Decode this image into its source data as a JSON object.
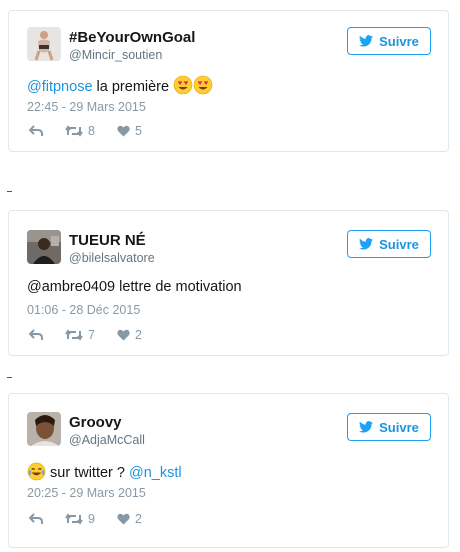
{
  "tweets": [
    {
      "display_name": "#BeYourOwnGoal",
      "handle": "@Mincir_soutien",
      "follow_label": "Suivre",
      "text_mention": "@fitpnose",
      "text_body": " la première ",
      "timestamp": "22:45 - 29 Mars 2015",
      "retweets": "8",
      "likes": "5"
    },
    {
      "display_name": "TUEUR NÉ",
      "handle": "@bilelsalvatore",
      "follow_label": "Suivre",
      "text_body": "@ambre0409 lettre de motivation",
      "timestamp": "01:06 - 28 Déc 2015",
      "retweets": "7",
      "likes": "2"
    },
    {
      "display_name": "Groovy",
      "handle": "@AdjaMcCall",
      "follow_label": "Suivre",
      "text_body": " sur twitter ? ",
      "text_mention": "@n_kstl",
      "timestamp": "20:25 - 29 Mars 2015",
      "retweets": "9",
      "likes": "2"
    }
  ],
  "separators": [
    "-",
    "-"
  ],
  "colors": {
    "accent": "#1b95e0",
    "muted": "#8899a6",
    "border": "#e1e8ed"
  },
  "icons": [
    "twitter-bird-icon",
    "reply-icon",
    "retweet-icon",
    "heart-icon",
    "heart-eyes-emoji",
    "tears-of-joy-emoji"
  ]
}
